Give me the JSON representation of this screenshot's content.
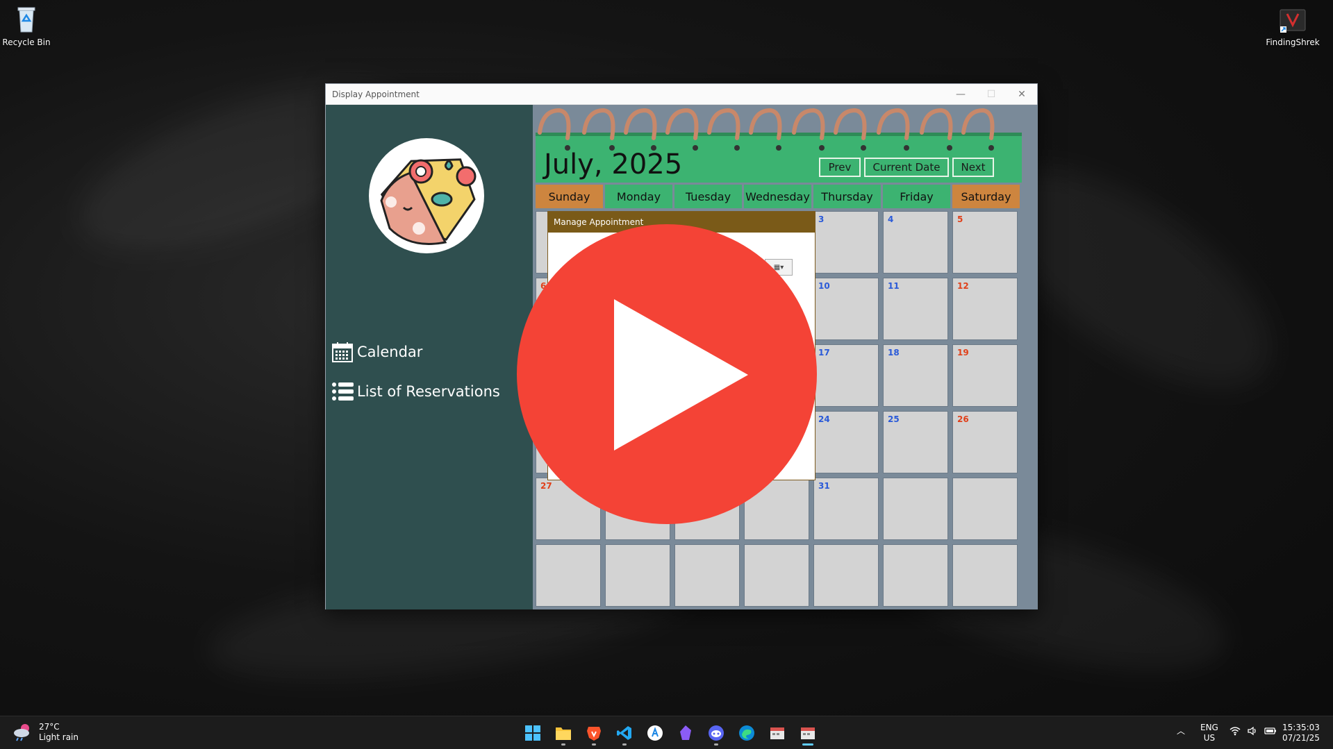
{
  "desktop": {
    "icons": [
      {
        "label": "Recycle Bin",
        "icon": "recycle-bin-icon"
      },
      {
        "label": "FindingShrek",
        "icon": "app-shortcut-icon"
      }
    ]
  },
  "window": {
    "title": "Display Appointment",
    "controls": {
      "minimize": "—",
      "maximize": "☐",
      "close": "✕"
    }
  },
  "sidebar": {
    "items": [
      {
        "label": "Calendar",
        "icon": "calendar-icon"
      },
      {
        "label": "List of Reservations",
        "icon": "list-icon"
      }
    ]
  },
  "calendar": {
    "month_title": "July, 2025",
    "buttons": {
      "prev": "Prev",
      "current": "Current Date",
      "next": "Next"
    },
    "weekdays": [
      "Sunday",
      "Monday",
      "Tuesday",
      "Wednesday",
      "Thursday",
      "Friday",
      "Saturday"
    ],
    "visible_days": {
      "row0": [
        "",
        "",
        "",
        "",
        "3",
        "4",
        "5"
      ],
      "row1": [
        "6",
        "",
        "",
        "",
        "10",
        "11",
        "12"
      ],
      "row2": [
        "",
        "",
        "",
        "",
        "17",
        "18",
        "19"
      ],
      "row3": [
        "",
        "",
        "",
        "",
        "24",
        "25",
        "26"
      ],
      "row4": [
        "27",
        "",
        "",
        "",
        "31",
        "",
        ""
      ],
      "row5": [
        "",
        "",
        "",
        "",
        "",
        "",
        ""
      ]
    },
    "colors": {
      "header": "#3cb371",
      "weekend": "#cd853f",
      "sidebar": "#2f4f4f",
      "weekday_num": "#2a5ad8",
      "weekend_num": "#e0401a"
    }
  },
  "dialog": {
    "title": "Manage Appointment"
  },
  "overlay": {
    "icon": "play-button-icon",
    "color": "#f44336"
  },
  "taskbar": {
    "weather": {
      "temp": "27°C",
      "condition": "Light rain"
    },
    "apps": [
      "windows-start-icon",
      "file-explorer-icon",
      "brave-browser-icon",
      "vscode-icon",
      "app-store-icon",
      "obsidian-icon",
      "discord-icon",
      "edge-icon",
      "calendar-app-icon",
      "display-appointment-icon"
    ],
    "language": {
      "line1": "ENG",
      "line2": "US"
    },
    "time": "15:35:03",
    "date": "07/21/25"
  }
}
